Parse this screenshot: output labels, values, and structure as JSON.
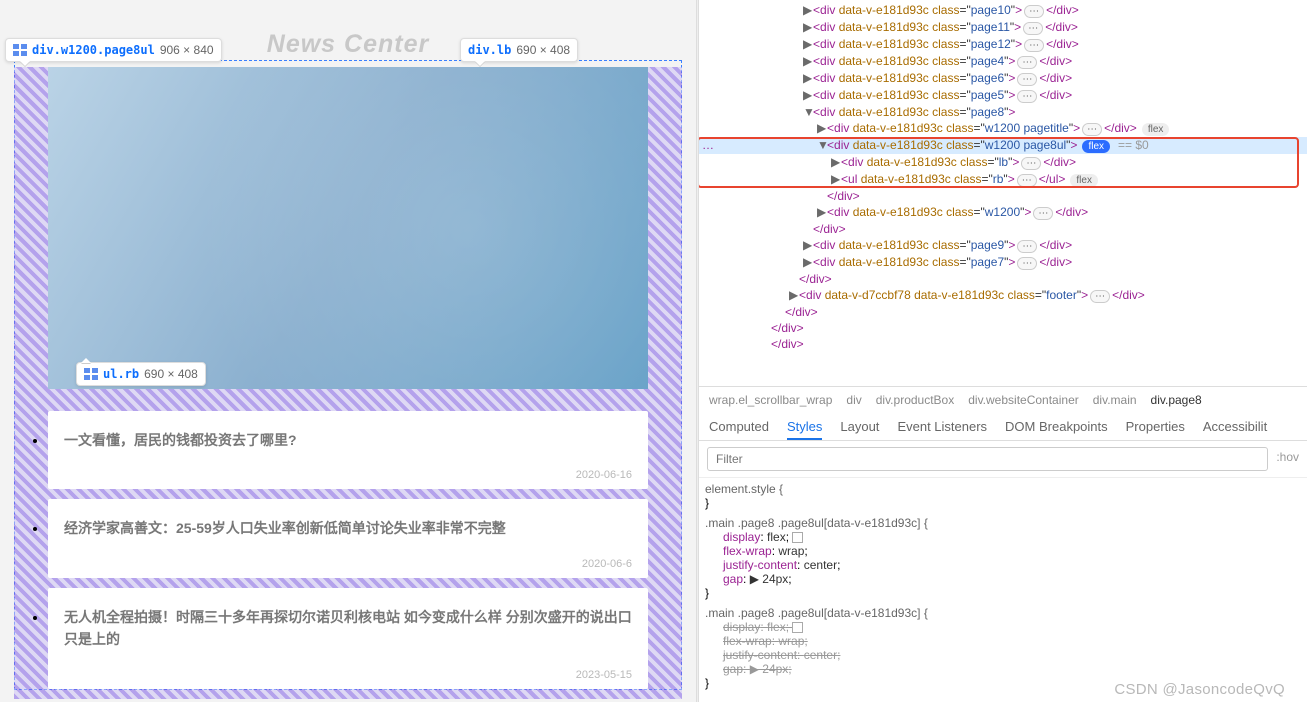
{
  "preview": {
    "news_heading": "News Center",
    "tooltips": {
      "t1_sel": "div.w1200.page8ul",
      "t1_size": "906 × 840",
      "t2_sel": "div.lb",
      "t2_size": "690 × 408",
      "t3_sel": "ul.rb",
      "t3_size": "690 × 408"
    },
    "articles": [
      {
        "title": "一文看懂，居民的钱都投资去了哪里?",
        "date": "2020-06-16"
      },
      {
        "title": "经济学家高善文：25-59岁人口失业率创新低简单讨论失业率非常不完整",
        "date": "2020-06-6"
      },
      {
        "title": "无人机全程拍摄！时隔三十多年再探切尔诺贝利核电站 如今变成什么样 分别次盛开的说出口只是上的",
        "date": "2023-05-15"
      }
    ]
  },
  "dom": {
    "vattr": "data-v-e181d93c",
    "rows": [
      {
        "ind": "ind1",
        "arr": "▶",
        "cls": "page10",
        "ell": true,
        "close": "</div>"
      },
      {
        "ind": "ind1",
        "arr": "▶",
        "cls": "page11",
        "ell": true,
        "close": "</div>"
      },
      {
        "ind": "ind1",
        "arr": "▶",
        "cls": "page12",
        "ell": true,
        "close": "</div>"
      },
      {
        "ind": "ind1",
        "arr": "▶",
        "cls": "page4",
        "ell": true,
        "close": "</div>"
      },
      {
        "ind": "ind1",
        "arr": "▶",
        "cls": "page6",
        "ell": true,
        "close": "</div>"
      },
      {
        "ind": "ind1",
        "arr": "▶",
        "cls": "page5",
        "ell": true,
        "close": "</div>"
      },
      {
        "ind": "ind1",
        "arr": "▼",
        "cls": "page8",
        "ell": false,
        "close": ""
      },
      {
        "ind": "ind2",
        "arr": "▶",
        "cls": "w1200 pagetitle",
        "ell": true,
        "close": "</div>",
        "pillg": "flex"
      }
    ],
    "selrow": {
      "ind": "ind2",
      "arr": "▼",
      "cls": "w1200 page8ul",
      "pill": "flex",
      "hint": "== $0"
    },
    "childrows": [
      {
        "ind": "ind3",
        "arr": "▶",
        "tag": "div",
        "cls": "lb",
        "ell": true,
        "close": "</div>"
      },
      {
        "ind": "ind3",
        "arr": "▶",
        "tag": "ul",
        "cls": "rb",
        "ell": true,
        "close": "</ul>",
        "pillg": "flex"
      }
    ],
    "tail": [
      {
        "ind": "ind2",
        "text": "</div>"
      },
      {
        "ind": "ind2",
        "arr": "▶",
        "cls": "w1200",
        "ell": true,
        "close": "</div>"
      },
      {
        "ind": "ind1",
        "text": "</div>"
      },
      {
        "ind": "ind1",
        "arr": "▶",
        "cls": "page9",
        "ell": true,
        "close": "</div>"
      },
      {
        "ind": "ind1",
        "arr": "▶",
        "cls": "page7",
        "ell": true,
        "close": "</div>"
      },
      {
        "ind": "ind0",
        "text": "</div>"
      },
      {
        "ind": "ind0",
        "arr": "▶",
        "vattr2": "data-v-d7ccbf78",
        "cls": "footer",
        "ell": true,
        "close": "</div>"
      },
      {
        "ind": "indm",
        "text": "</div>"
      },
      {
        "ind": "indmm",
        "text": "</div>"
      },
      {
        "ind": "indmm",
        "text": "</div>"
      }
    ],
    "gutter_mark": "…"
  },
  "crumbs": [
    "wrap.el_scrollbar_wrap",
    "div",
    "div.productBox",
    "div.websiteContainer",
    "div.main",
    "div.page8"
  ],
  "tabs": [
    "Computed",
    "Styles",
    "Layout",
    "Event Listeners",
    "DOM Breakpoints",
    "Properties",
    "Accessibilit"
  ],
  "tabs_active": 1,
  "filter": {
    "placeholder": "Filter",
    "hov": ":hov"
  },
  "styles": {
    "elstyle_label": "element.style {",
    "rule1": {
      "sel": ".main .page8 .page8ul[data-v-e181d93c] {",
      "props": [
        {
          "k": "display",
          "v": "flex",
          "sw": true
        },
        {
          "k": "flex-wrap",
          "v": "wrap"
        },
        {
          "k": "justify-content",
          "v": "center"
        },
        {
          "k": "gap",
          "v": "▶ 24px"
        }
      ]
    },
    "rule2": {
      "sel": ".main .page8 .page8ul[data-v-e181d93c] {",
      "props": [
        {
          "k": "display",
          "v": "flex",
          "sw": true,
          "str": true
        },
        {
          "k": "flex-wrap",
          "v": "wrap",
          "str": true
        },
        {
          "k": "justify-content",
          "v": "center",
          "str": true
        },
        {
          "k": "gap",
          "v": "▶ 24px",
          "str": true
        }
      ]
    }
  },
  "watermark": "CSDN @JasoncodeQvQ"
}
